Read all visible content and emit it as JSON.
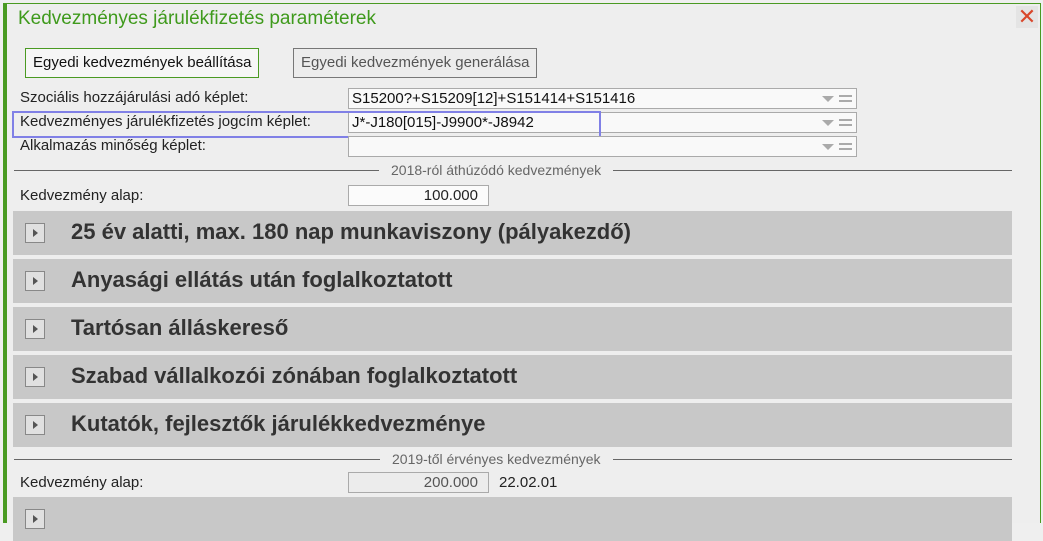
{
  "window": {
    "title": "Kedvezményes járulékfizetés paraméterek",
    "close_icon": "close-icon"
  },
  "buttons": {
    "setup": "Egyedi kedvezmények beállítása",
    "generate": "Egyedi kedvezmények generálása"
  },
  "fields": [
    {
      "label": "Szociális hozzájárulási adó képlet:",
      "value": "S15200?+S15209[12]+S151414+S151416"
    },
    {
      "label": "Kedvezményes járulékfizetés jogcím képlet:",
      "value": "J*-J180[015]-J9900*-J8942"
    },
    {
      "label": "Alkalmazás minőség képlet:",
      "value": ""
    }
  ],
  "section2018": {
    "title": "2018-ról áthúzódó kedvezmények",
    "base_label": "Kedvezmény alap:",
    "base_value": "100.000",
    "rows": [
      "25 év alatti, max. 180 nap munkaviszony (pályakezdő)",
      "Anyasági ellátás után foglalkoztatott",
      "Tartósan álláskereső",
      "Szabad vállalkozói zónában foglalkoztatott",
      "Kutatók, fejlesztők járulékkedvezménye"
    ]
  },
  "section2019": {
    "title": "2019-től érvényes kedvezmények",
    "base_label": "Kedvezmény alap:",
    "base_value": "200.000",
    "date": "22.02.01"
  }
}
